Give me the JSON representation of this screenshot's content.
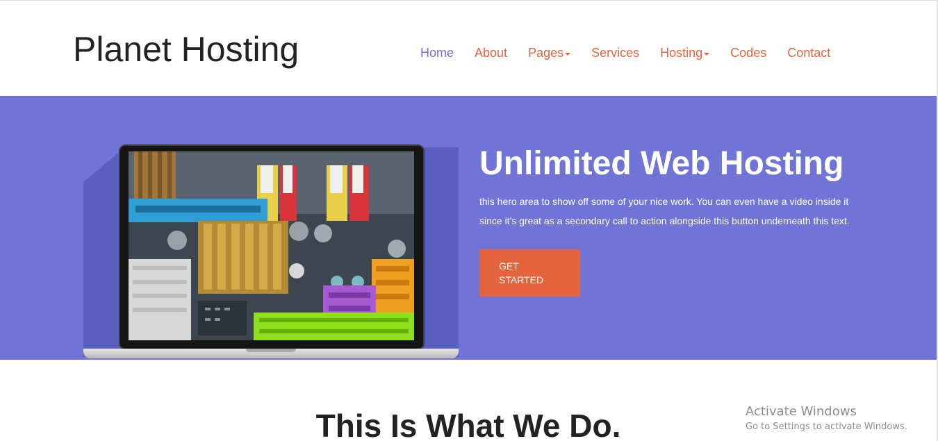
{
  "header": {
    "brand": "Planet Hosting",
    "nav": [
      {
        "label": "Home",
        "has_dropdown": false,
        "active": true
      },
      {
        "label": "About",
        "has_dropdown": false,
        "active": false
      },
      {
        "label": "Pages",
        "has_dropdown": true,
        "active": false
      },
      {
        "label": "Services",
        "has_dropdown": false,
        "active": false
      },
      {
        "label": "Hosting",
        "has_dropdown": true,
        "active": false
      },
      {
        "label": "Codes",
        "has_dropdown": false,
        "active": false
      },
      {
        "label": "Contact",
        "has_dropdown": false,
        "active": false
      }
    ]
  },
  "hero": {
    "title": "Unlimited Web Hosting",
    "text_line1": "this hero area to show off some of your nice work. You can even have a video inside it",
    "text_line2": "since it's great as a secondary call to action alongside this button underneath this text.",
    "button_line1": "GET",
    "button_line2": "STARTED",
    "image_icon": "laptop-motherboard-image"
  },
  "section": {
    "title": "This Is What We Do."
  },
  "watermark": {
    "line1": "Activate Windows",
    "line2": "Go to Settings to activate Windows."
  },
  "colors": {
    "accent": "#e4643e",
    "hero_bg": "#7074d6",
    "nav_active": "#6e71cc",
    "text_dark": "#222222"
  }
}
